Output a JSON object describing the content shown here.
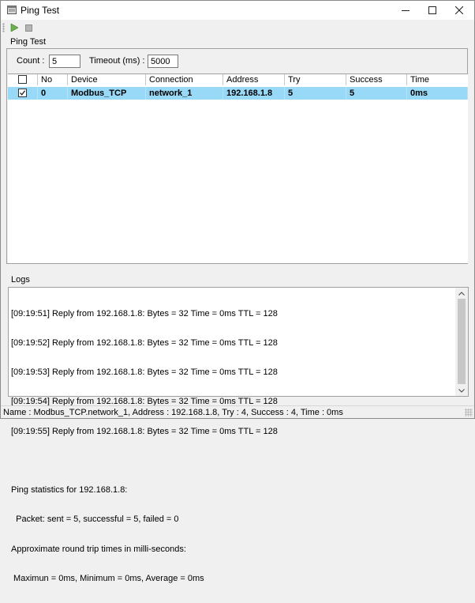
{
  "window": {
    "title": "Ping Test",
    "icons": {
      "app": "window-app-icon",
      "minimize": "minimize-icon",
      "maximize": "maximize-icon",
      "close": "close-icon"
    }
  },
  "toolbar": {
    "play_icon": "play-icon",
    "stop_icon": "stop-icon",
    "play_color": "#4caf50",
    "stop_color": "#9e9e9e"
  },
  "ping": {
    "section_label": "Ping Test",
    "count_label": "Count :",
    "count_value": "5",
    "timeout_label": "Timeout (ms) :",
    "timeout_value": "5000",
    "columns": [
      "No",
      "Device",
      "Connection",
      "Address",
      "Try",
      "Success",
      "Time"
    ],
    "rows": [
      {
        "checked": true,
        "no": "0",
        "device": "Modbus_TCP",
        "connection": "network_1",
        "address": "192.168.1.8",
        "try": "5",
        "success": "5",
        "time": "0ms"
      }
    ],
    "selected_row_color": "#99d9f8"
  },
  "logs": {
    "section_label": "Logs",
    "lines": [
      "[09:19:51] Reply from 192.168.1.8: Bytes = 32 Time = 0ms TTL = 128",
      "[09:19:52] Reply from 192.168.1.8: Bytes = 32 Time = 0ms TTL = 128",
      "[09:19:53] Reply from 192.168.1.8: Bytes = 32 Time = 0ms TTL = 128",
      "[09:19:54] Reply from 192.168.1.8: Bytes = 32 Time = 0ms TTL = 128",
      "[09:19:55] Reply from 192.168.1.8: Bytes = 32 Time = 0ms TTL = 128",
      "",
      "Ping statistics for 192.168.1.8:",
      "  Packet: sent = 5, successful = 5, failed = 0",
      "Approximate round trip times in milli-seconds:",
      " Maximun = 0ms, Minimum = 0ms, Average = 0ms"
    ]
  },
  "status": {
    "text": "Name : Modbus_TCP.network_1, Address : 192.168.1.8, Try : 4, Success : 4, Time : 0ms"
  }
}
